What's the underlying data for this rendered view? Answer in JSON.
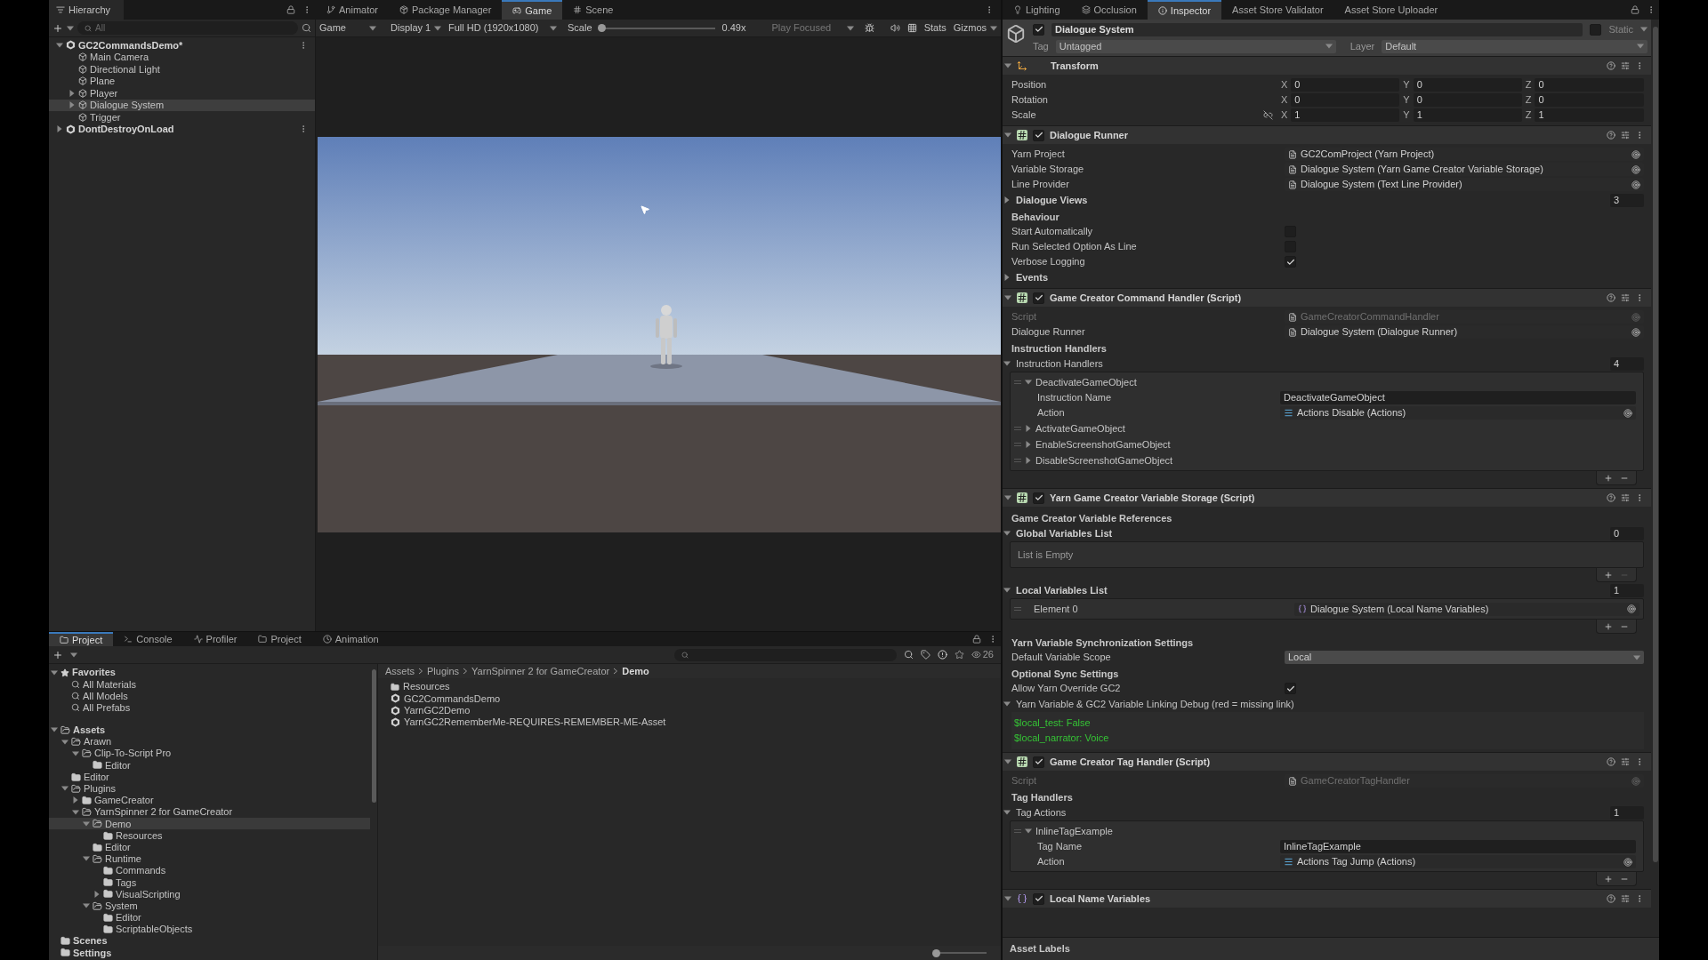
{
  "hierarchy": {
    "title": "Hierarchy",
    "search": {
      "placeholder": "All"
    },
    "items": [
      {
        "label": "GC2CommandsDemo*",
        "kind": "scene",
        "expanded": true,
        "selected": false,
        "children": [
          {
            "label": "Main Camera",
            "kind": "object",
            "selected": false
          },
          {
            "label": "Directional Light",
            "kind": "object",
            "selected": false
          },
          {
            "label": "Plane",
            "kind": "object",
            "selected": false
          },
          {
            "label": "Player",
            "kind": "object",
            "expanded": false,
            "selected": false
          },
          {
            "label": "Dialogue System",
            "kind": "object",
            "expanded": false,
            "selected": true
          },
          {
            "label": "Trigger",
            "kind": "object",
            "selected": false
          }
        ]
      },
      {
        "label": "DontDestroyOnLoad",
        "kind": "scene",
        "expanded": false,
        "selected": false
      }
    ]
  },
  "game_panel": {
    "tabs": [
      {
        "label": "Animator",
        "selected": false
      },
      {
        "label": "Package Manager",
        "selected": false
      },
      {
        "label": "Game",
        "selected": true
      },
      {
        "label": "Scene",
        "selected": false
      }
    ],
    "toolbar": {
      "mode": "Game",
      "display": "Display 1",
      "resolution": "Full HD (1920x1080)",
      "scale_label": "Scale",
      "scale": {
        "level": 0.02
      },
      "scale_value": "0.49x",
      "play_mode": "Play Focused",
      "stats": "Stats",
      "gizmos": "Gizmos"
    }
  },
  "inspector": {
    "tabs": [
      {
        "label": "Lighting",
        "selected": false
      },
      {
        "label": "Occlusion",
        "selected": false
      },
      {
        "label": "Inspector",
        "selected": true
      },
      {
        "label": "Asset Store Validator",
        "selected": false
      },
      {
        "label": "Asset Store Uploader",
        "selected": false
      }
    ],
    "object": {
      "name": "Dialogue System",
      "active": true,
      "static_label": "Static",
      "static": false,
      "tag_label": "Tag",
      "tag": "Untagged",
      "layer_label": "Layer",
      "layer": "Default"
    },
    "components": [
      {
        "title": "Transform",
        "kind": "transform",
        "expanded": true,
        "rows": [
          {
            "kind": "vector",
            "label": "Position",
            "values": [
              {
                "axis": "X",
                "value": "0"
              },
              {
                "axis": "Y",
                "value": "0"
              },
              {
                "axis": "Z",
                "value": "0"
              }
            ]
          },
          {
            "kind": "vector",
            "label": "Rotation",
            "values": [
              {
                "axis": "X",
                "value": "0"
              },
              {
                "axis": "Y",
                "value": "0"
              },
              {
                "axis": "Z",
                "value": "0"
              }
            ]
          },
          {
            "kind": "vector",
            "label": "Scale",
            "constrained": false,
            "values": [
              {
                "axis": "X",
                "value": "1"
              },
              {
                "axis": "Y",
                "value": "1"
              },
              {
                "axis": "Z",
                "value": "1"
              }
            ]
          }
        ]
      },
      {
        "title": "Dialogue Runner",
        "kind": "script",
        "enabled": true,
        "expanded": true,
        "rows": [
          {
            "kind": "object",
            "label": "Yarn Project",
            "value": "GC2ComProject (Yarn Project)",
            "disabled": false
          },
          {
            "kind": "object",
            "label": "Variable Storage",
            "value": "Dialogue System (Yarn Game Creator Variable Storage)",
            "disabled": false
          },
          {
            "kind": "object",
            "label": "Line Provider",
            "value": "Dialogue System (Text Line Provider)",
            "disabled": false
          },
          {
            "kind": "foldout",
            "label": "Dialogue Views",
            "expanded": false,
            "count": "3"
          },
          {
            "kind": "header",
            "label": "Behaviour"
          },
          {
            "kind": "checkbox",
            "label": "Start Automatically",
            "checked": false
          },
          {
            "kind": "checkbox",
            "label": "Run Selected Option As Line",
            "checked": false
          },
          {
            "kind": "checkbox",
            "label": "Verbose Logging",
            "checked": true
          },
          {
            "kind": "foldout",
            "label": "Events",
            "expanded": false
          }
        ]
      },
      {
        "title": "Game Creator Command Handler (Script)",
        "kind": "script",
        "enabled": true,
        "expanded": true,
        "rows": [
          {
            "kind": "object",
            "label": "Script",
            "value": "GameCreatorCommandHandler",
            "disabled": true
          },
          {
            "kind": "object",
            "label": "Dialogue Runner",
            "value": "Dialogue System (Dialogue Runner)",
            "disabled": false
          },
          {
            "kind": "header",
            "label": "Instruction Handlers"
          },
          {
            "kind": "foldout",
            "label": "Instruction Handlers",
            "expanded": true,
            "count": "4",
            "plain": true
          },
          {
            "kind": "list",
            "remove_enabled": true,
            "items": [
              {
                "label": "DeactivateGameObject",
                "expanded": true,
                "rows": [
                  {
                    "kind": "text",
                    "label": "Instruction Name",
                    "value": "DeactivateGameObject"
                  },
                  {
                    "kind": "action",
                    "label": "Action",
                    "value": "Actions Disable (Actions)",
                    "disabled": false
                  }
                ]
              },
              {
                "label": "ActivateGameObject",
                "expanded": false
              },
              {
                "label": "EnableScreenshotGameObject",
                "expanded": false
              },
              {
                "label": "DisableScreenshotGameObject",
                "expanded": false
              }
            ]
          }
        ]
      },
      {
        "title": "Yarn Game Creator Variable Storage (Script)",
        "kind": "script",
        "enabled": true,
        "expanded": true,
        "rows": [
          {
            "kind": "header",
            "label": "Game Creator Variable References"
          },
          {
            "kind": "foldout",
            "label": "Global Variables List",
            "expanded": true,
            "count": "0"
          },
          {
            "kind": "list",
            "empty_text": "List is Empty",
            "remove_enabled": false,
            "items": []
          },
          {
            "kind": "foldout",
            "label": "Local Variables List",
            "expanded": true,
            "count": "1"
          },
          {
            "kind": "list",
            "remove_enabled": true,
            "items": [
              {
                "label": "Element 0",
                "value": "Dialogue System (Local Name Variables)",
                "kind": "variables"
              }
            ]
          },
          {
            "kind": "header",
            "label": "Yarn Variable Synchronization Settings"
          },
          {
            "kind": "dropdown",
            "label": "Default Variable Scope",
            "value": "Local"
          },
          {
            "kind": "header",
            "label": "Optional Sync Settings"
          },
          {
            "kind": "checkbox",
            "label": "Allow Yarn Override GC2",
            "checked": true
          },
          {
            "kind": "foldout",
            "label": "Yarn Variable & GC2 Variable Linking Debug (red = missing link)",
            "expanded": true,
            "plain": true
          },
          {
            "kind": "debug",
            "lines": [
              "$local_test: False",
              "$local_narrator: Voice"
            ]
          }
        ]
      },
      {
        "title": "Game Creator Tag Handler (Script)",
        "kind": "script",
        "enabled": true,
        "expanded": true,
        "rows": [
          {
            "kind": "object",
            "label": "Script",
            "value": "GameCreatorTagHandler",
            "disabled": true
          },
          {
            "kind": "header",
            "label": "Tag Handlers"
          },
          {
            "kind": "foldout",
            "label": "Tag Actions",
            "expanded": true,
            "count": "1",
            "plain": true
          },
          {
            "kind": "list",
            "remove_enabled": true,
            "items": [
              {
                "label": "InlineTagExample",
                "expanded": true,
                "rows": [
                  {
                    "kind": "text",
                    "label": "Tag Name",
                    "value": "InlineTagExample"
                  },
                  {
                    "kind": "action",
                    "label": "Action",
                    "value": "Actions Tag Jump (Actions)",
                    "disabled": false
                  }
                ]
              }
            ]
          }
        ]
      },
      {
        "title": "Local Name Variables",
        "kind": "variables",
        "enabled": true,
        "expanded": true
      }
    ],
    "asset_labels": "Asset Labels"
  },
  "project_panel": {
    "tabs": [
      {
        "label": "Project",
        "selected": true
      },
      {
        "label": "Console",
        "selected": false
      },
      {
        "label": "Profiler",
        "selected": false
      },
      {
        "label": "Project",
        "selected": false
      },
      {
        "label": "Animation",
        "selected": false
      }
    ],
    "visible_count": "26",
    "tree": [
      {
        "label": "Favorites",
        "kind": "favorites",
        "expanded": true,
        "selected": false,
        "children": [
          {
            "label": "All Materials",
            "kind": "search",
            "selected": false
          },
          {
            "label": "All Models",
            "kind": "search",
            "selected": false
          },
          {
            "label": "All Prefabs",
            "kind": "search",
            "selected": false
          }
        ]
      },
      {
        "label": "Assets",
        "kind": "folder",
        "expanded": true,
        "selected": false,
        "children": [
          {
            "label": "Arawn",
            "kind": "folder",
            "expanded": true,
            "selected": false,
            "children": [
              {
                "label": "Clip-To-Script Pro",
                "kind": "folder",
                "expanded": true,
                "selected": false,
                "children": [
                  {
                    "label": "Editor",
                    "kind": "folder",
                    "selected": false
                  }
                ]
              }
            ]
          },
          {
            "label": "Editor",
            "kind": "folder",
            "selected": false
          },
          {
            "label": "Plugins",
            "kind": "folder",
            "expanded": true,
            "selected": false,
            "children": [
              {
                "label": "GameCreator",
                "kind": "folder",
                "expanded": false,
                "selected": false
              },
              {
                "label": "YarnSpinner 2 for GameCreator",
                "kind": "folder",
                "expanded": true,
                "selected": false,
                "children": [
                  {
                    "label": "Demo",
                    "kind": "folder",
                    "expanded": true,
                    "selected": true,
                    "children": [
                      {
                        "label": "Resources",
                        "kind": "folder",
                        "selected": false
                      }
                    ]
                  },
                  {
                    "label": "Editor",
                    "kind": "folder",
                    "selected": false
                  },
                  {
                    "label": "Runtime",
                    "kind": "folder",
                    "expanded": true,
                    "selected": false,
                    "children": [
                      {
                        "label": "Commands",
                        "kind": "folder",
                        "selected": false
                      },
                      {
                        "label": "Tags",
                        "kind": "folder",
                        "selected": false
                      },
                      {
                        "label": "VisualScripting",
                        "kind": "folder",
                        "expanded": false,
                        "selected": false
                      }
                    ]
                  },
                  {
                    "label": "System",
                    "kind": "folder",
                    "expanded": true,
                    "selected": false,
                    "children": [
                      {
                        "label": "Editor",
                        "kind": "folder",
                        "selected": false
                      },
                      {
                        "label": "ScriptableObjects",
                        "kind": "folder",
                        "selected": false
                      }
                    ]
                  }
                ]
              }
            ]
          }
        ]
      },
      {
        "label": "Scenes",
        "kind": "folder",
        "selected": false
      },
      {
        "label": "Settings",
        "kind": "folder",
        "selected": false
      }
    ],
    "breadcrumb": [
      "Assets",
      "Plugins",
      "YarnSpinner 2 for GameCreator",
      "Demo"
    ],
    "files": [
      {
        "name": "Resources",
        "kind": "folder"
      },
      {
        "name": "GC2CommandsDemo",
        "kind": "scene"
      },
      {
        "name": "YarnGC2Demo",
        "kind": "scene"
      },
      {
        "name": "YarnGC2RememberMe-REQUIRES-REMEMBER-ME-Asset",
        "kind": "scene"
      }
    ],
    "zoom": {
      "level": 0.05
    }
  }
}
